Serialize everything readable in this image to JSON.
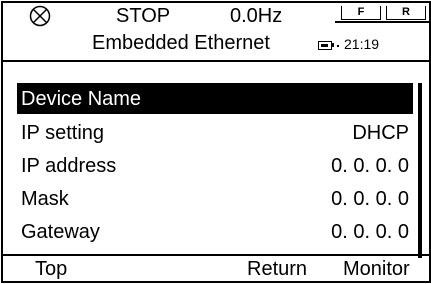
{
  "status": {
    "state": "STOP",
    "frequency": "0.0Hz",
    "f_label": "F",
    "r_label": "R",
    "time": "21:19"
  },
  "title": "Embedded Ethernet",
  "menu": {
    "items": [
      {
        "label": "Device Name",
        "value": "",
        "selected": true
      },
      {
        "label": "IP setting",
        "value": "DHCP"
      },
      {
        "label": "IP address",
        "value": "0. 0. 0. 0"
      },
      {
        "label": "Mask",
        "value": "0. 0. 0. 0"
      },
      {
        "label": "Gateway",
        "value": "0. 0. 0. 0"
      }
    ]
  },
  "footer": {
    "left": "Top",
    "center": "Return",
    "right": "Monitor"
  },
  "icons": {
    "stop_indicator": "circle-x-icon",
    "battery": "battery-icon"
  }
}
